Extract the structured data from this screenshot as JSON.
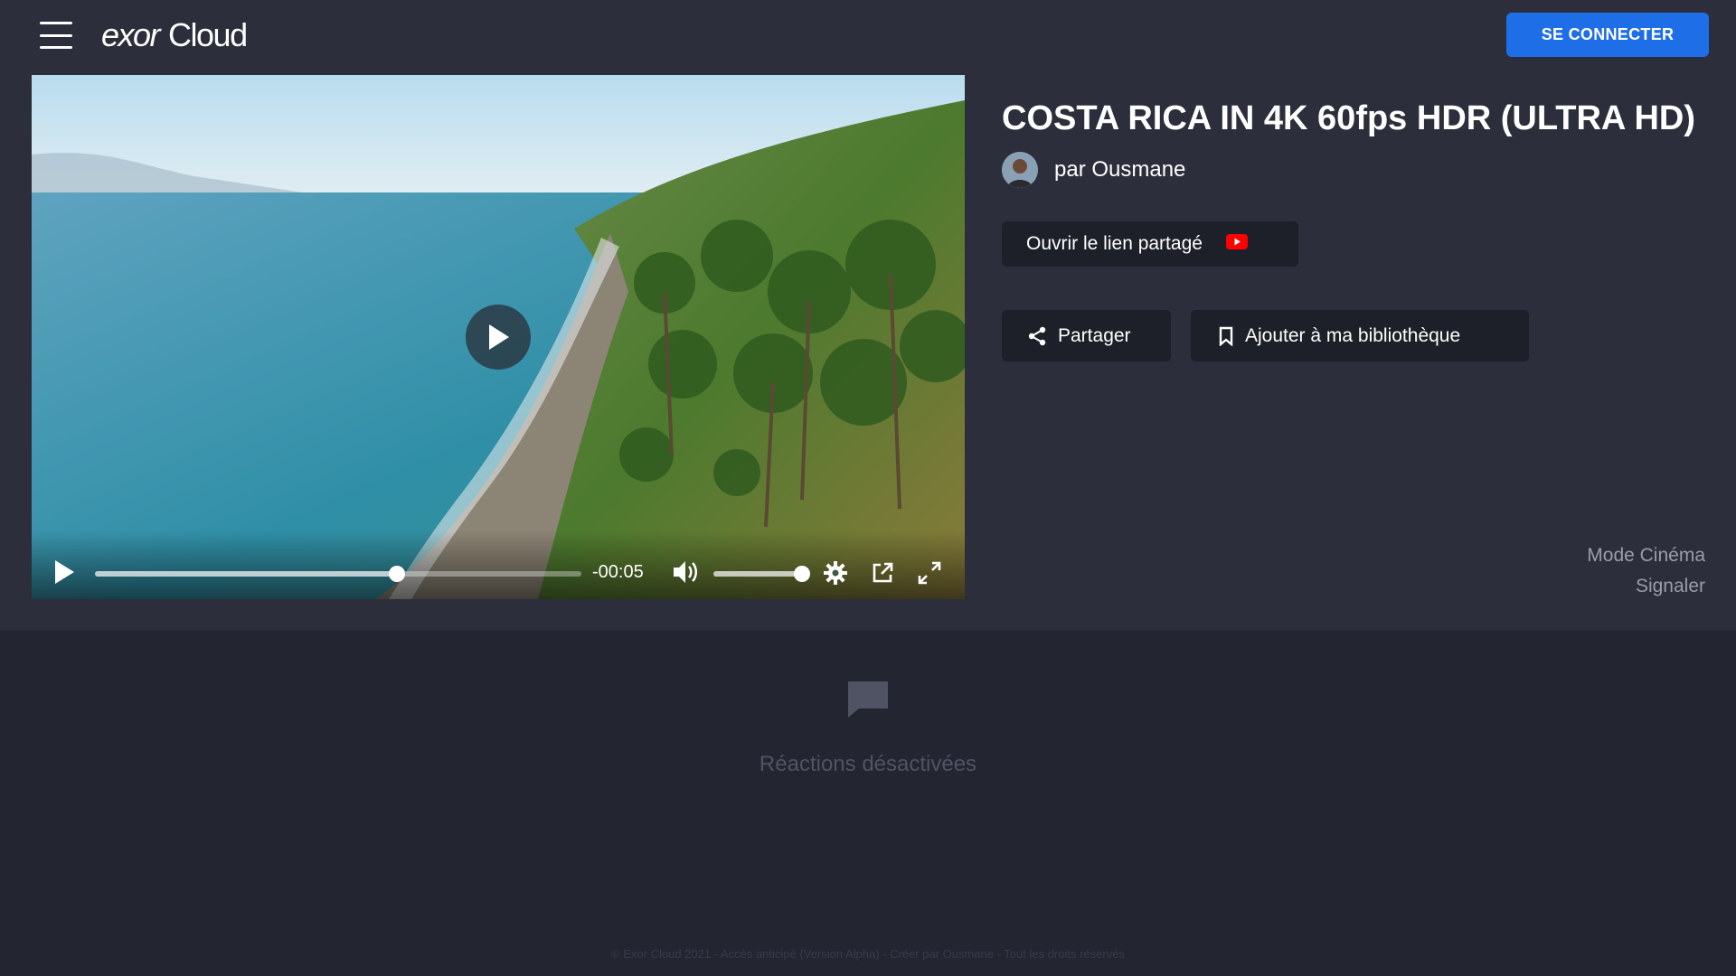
{
  "header": {
    "logo_brand": "exor",
    "logo_product": "Cloud",
    "login_label": "SE CONNECTER"
  },
  "player": {
    "time_remaining": "-00:05",
    "progress_fraction": 0.62,
    "volume_fraction": 1.0
  },
  "video": {
    "title": "COSTA RICA IN 4K 60fps HDR (ULTRA HD)",
    "author": "par Ousmane",
    "open_link_label": "Ouvrir le lien partagé",
    "share_label": "Partager",
    "library_label": "Ajouter à ma bibliothèque",
    "cinema_mode_label": "Mode Cinéma",
    "report_label": "Signaler"
  },
  "reactions": {
    "disabled_text": "Réactions désactivées"
  },
  "footer": {
    "text": "© Exor Cloud 2021 - Accès anticipé (Version Alpha) - Créer par Ousmane - Tout les droits réservés"
  },
  "colors": {
    "accent": "#1e6ee8",
    "background": "#232631",
    "top_section": "#2c2f3b",
    "button_dark": "#1e2029",
    "youtube_red": "#ff0000"
  }
}
